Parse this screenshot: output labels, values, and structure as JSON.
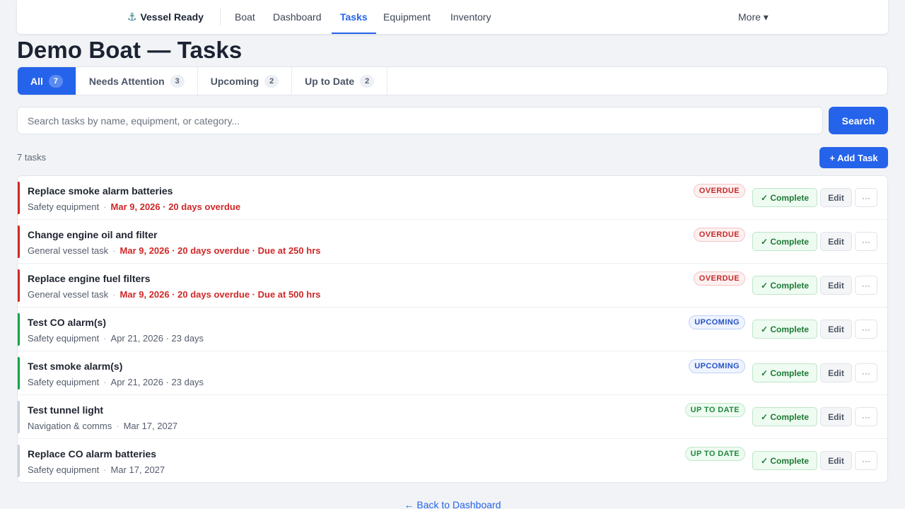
{
  "nav": {
    "brand": "Vessel Ready",
    "brand_icon": "⚓",
    "links": [
      "Boat",
      "Dashboard",
      "Tasks",
      "Equipment",
      "Inventory"
    ],
    "active": "Tasks",
    "more": "More ▾"
  },
  "page_title": "Demo Boat — Tasks",
  "tabs": [
    {
      "label": "All",
      "count": "7",
      "active": true
    },
    {
      "label": "Needs Attention",
      "count": "3",
      "active": false
    },
    {
      "label": "Upcoming",
      "count": "2",
      "active": false
    },
    {
      "label": "Up to Date",
      "count": "2",
      "active": false
    }
  ],
  "search": {
    "placeholder": "Search tasks by name, equipment, or category...",
    "value": "",
    "button_label": "Search"
  },
  "task_count_label": "7 tasks",
  "add_task_label": "+ Add Task",
  "actions": {
    "complete": "✓ Complete",
    "edit": "Edit",
    "more": "···"
  },
  "status_colors": {
    "overdue": "#d02828",
    "upcoming": "#16a34a",
    "uptodate": "#c9d0d8"
  },
  "tasks": [
    {
      "name": "Replace smoke alarm batteries",
      "category": "Safety equipment",
      "due": "Mar 9, 2026 · 20 days overdue",
      "status": "overdue",
      "badge": "OVERDUE"
    },
    {
      "name": "Change engine oil and filter",
      "category": "General vessel task",
      "due": "Mar 9, 2026 · 20 days overdue · Due at 250 hrs",
      "status": "overdue",
      "badge": "OVERDUE"
    },
    {
      "name": "Replace engine fuel filters",
      "category": "General vessel task",
      "due": "Mar 9, 2026 · 20 days overdue · Due at 500 hrs",
      "status": "overdue",
      "badge": "OVERDUE"
    },
    {
      "name": "Test CO alarm(s)",
      "category": "Safety equipment",
      "due": "Apr 21, 2026 · 23 days",
      "status": "upcoming",
      "badge": "UPCOMING"
    },
    {
      "name": "Test smoke alarm(s)",
      "category": "Safety equipment",
      "due": "Apr 21, 2026 · 23 days",
      "status": "upcoming",
      "badge": "UPCOMING"
    },
    {
      "name": "Test tunnel light",
      "category": "Navigation & comms",
      "due": "Mar 17, 2027",
      "status": "uptodate",
      "badge": "UP TO DATE"
    },
    {
      "name": "Replace CO alarm batteries",
      "category": "Safety equipment",
      "due": "Mar 17, 2027",
      "status": "uptodate",
      "badge": "UP TO DATE"
    }
  ],
  "back_link": "← Back to Dashboard"
}
